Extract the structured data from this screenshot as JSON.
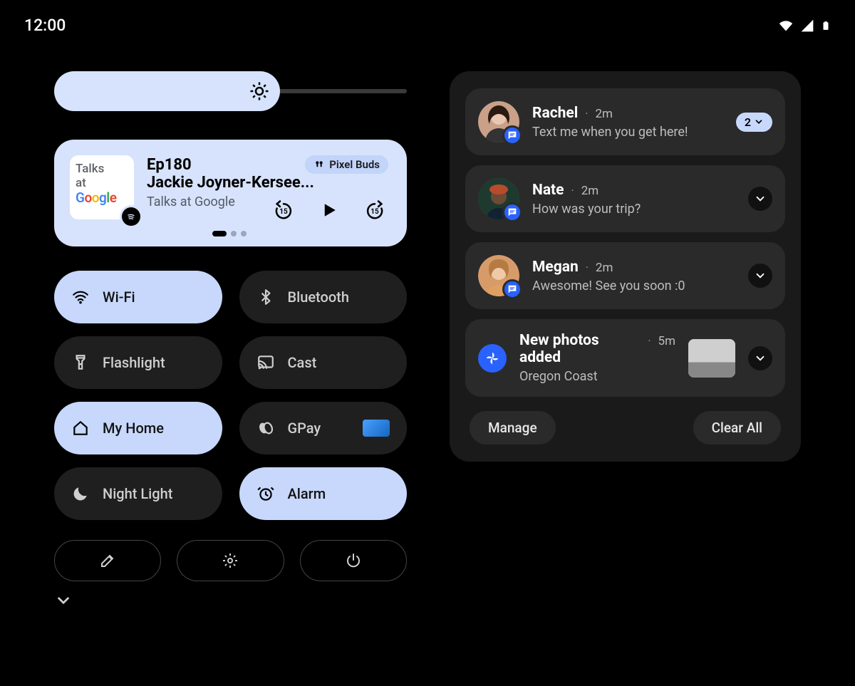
{
  "status": {
    "time": "12:00"
  },
  "brightness": {
    "level_pct": 64
  },
  "media": {
    "art_line1": "Talks",
    "art_line2": "at",
    "title": "Ep180",
    "artist": "Jackie Joyner-Kersee...",
    "source": "Talks at Google",
    "output_label": "Pixel Buds",
    "skip_back_seconds": "15",
    "skip_fwd_seconds": "15"
  },
  "quick_settings": {
    "tiles": [
      {
        "id": "wifi",
        "label": "Wi-Fi",
        "on": true
      },
      {
        "id": "bluetooth",
        "label": "Bluetooth",
        "on": false
      },
      {
        "id": "flashlight",
        "label": "Flashlight",
        "on": false
      },
      {
        "id": "cast",
        "label": "Cast",
        "on": false
      },
      {
        "id": "home",
        "label": "My Home",
        "on": true
      },
      {
        "id": "gpay",
        "label": "GPay",
        "on": false
      },
      {
        "id": "nightlight",
        "label": "Night Light",
        "on": false
      },
      {
        "id": "alarm",
        "label": "Alarm",
        "on": true
      }
    ]
  },
  "notifications": {
    "items": [
      {
        "kind": "message",
        "sender": "Rachel",
        "time": "2m",
        "body": "Text me when you get here!",
        "count_chip": "2"
      },
      {
        "kind": "message",
        "sender": "Nate",
        "time": "2m",
        "body": "How was your trip?"
      },
      {
        "kind": "message",
        "sender": "Megan",
        "time": "2m",
        "body": "Awesome! See you soon :0"
      },
      {
        "kind": "app",
        "sender": "New photos added",
        "time": "5m",
        "body": "Oregon Coast"
      }
    ],
    "manage_label": "Manage",
    "clear_label": "Clear All"
  }
}
